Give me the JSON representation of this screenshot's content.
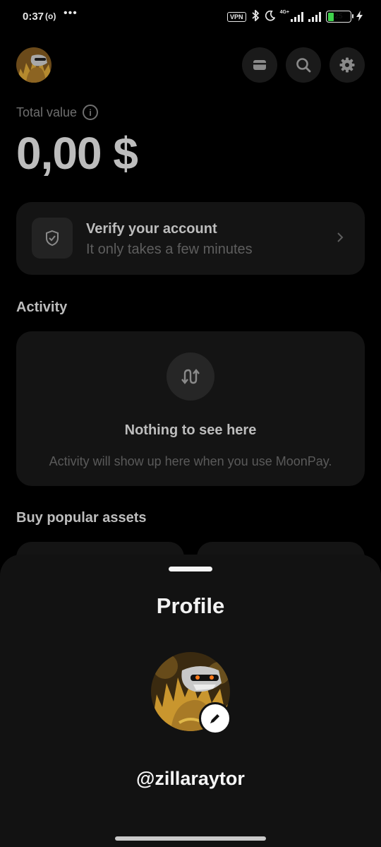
{
  "status_bar": {
    "time": "0:37",
    "record_indicator": "(o)",
    "more_dots": "•••",
    "vpn_label": "VPN",
    "network_label": "4G+",
    "battery_level": "25",
    "battery_color": "#3fd14b"
  },
  "header": {
    "avatar_icon": "dinosaur-avatar",
    "buttons": [
      {
        "icon": "card-icon"
      },
      {
        "icon": "search-icon"
      },
      {
        "icon": "gear-icon"
      }
    ]
  },
  "portfolio": {
    "total_label": "Total value",
    "info_icon": "info-icon",
    "total_value": "0,00 $"
  },
  "verify": {
    "title": "Verify your account",
    "subtitle": "It only takes a few minutes",
    "icon": "shield-check-icon"
  },
  "activity": {
    "title": "Activity",
    "icon": "transfer-arrows-icon",
    "empty_title": "Nothing to see here",
    "empty_desc": "Activity will show up here when you use MoonPay."
  },
  "buy": {
    "title": "Buy popular assets"
  },
  "profile_sheet": {
    "title": "Profile",
    "username": "@zillaraytor",
    "edit_icon": "pencil-icon"
  }
}
